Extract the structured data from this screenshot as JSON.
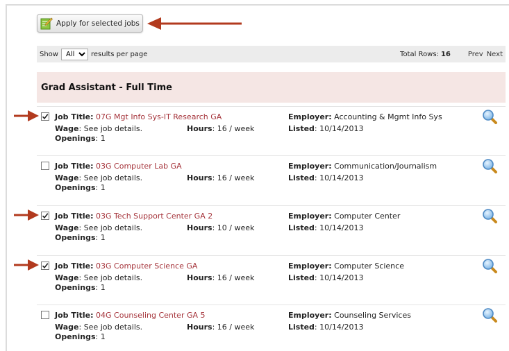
{
  "toolbar_button": {
    "label": "Apply for selected jobs"
  },
  "results": {
    "show_label": "Show",
    "per_page_value": "All",
    "per_page_suffix": "results per page",
    "total_rows_label": "Total Rows:",
    "total_rows_value": "16",
    "prev_label": "Prev",
    "next_label": "Next"
  },
  "group": {
    "title": "Grad Assistant - Full Time"
  },
  "labels": {
    "job_title": "Job Title:",
    "employer": "Employer:",
    "wage": "Wage",
    "hours": "Hours",
    "listed": "Listed",
    "openings": "Openings"
  },
  "jobs": [
    {
      "checked": true,
      "title": "07G Mgt Info Sys-IT Research GA",
      "employer": "Accounting & Mgmt Info Sys",
      "wage": "See job details.",
      "hours": "16 / week",
      "listed": "10/14/2013",
      "openings": "1"
    },
    {
      "checked": false,
      "title": "03G Computer Lab GA",
      "employer": "Communication/Journalism",
      "wage": "See job details.",
      "hours": "16 / week",
      "listed": "10/14/2013",
      "openings": "1"
    },
    {
      "checked": true,
      "title": "03G Tech Support Center GA 2",
      "employer": "Computer Center",
      "wage": "See job details.",
      "hours": "10 / week",
      "listed": "10/14/2013",
      "openings": "1"
    },
    {
      "checked": true,
      "title": "03G Computer Science GA",
      "employer": "Computer Science",
      "wage": "See job details.",
      "hours": "16 / week",
      "listed": "10/14/2013",
      "openings": "1"
    },
    {
      "checked": false,
      "title": "04G Counseling Center GA 5",
      "employer": "Counseling Services",
      "wage": "See job details.",
      "hours": "16 / week",
      "listed": "10/14/2013",
      "openings": "1"
    }
  ],
  "colors": {
    "arrow": "#b23a1e",
    "job_link": "#a5333a",
    "group_bg": "#f5e6e4"
  }
}
